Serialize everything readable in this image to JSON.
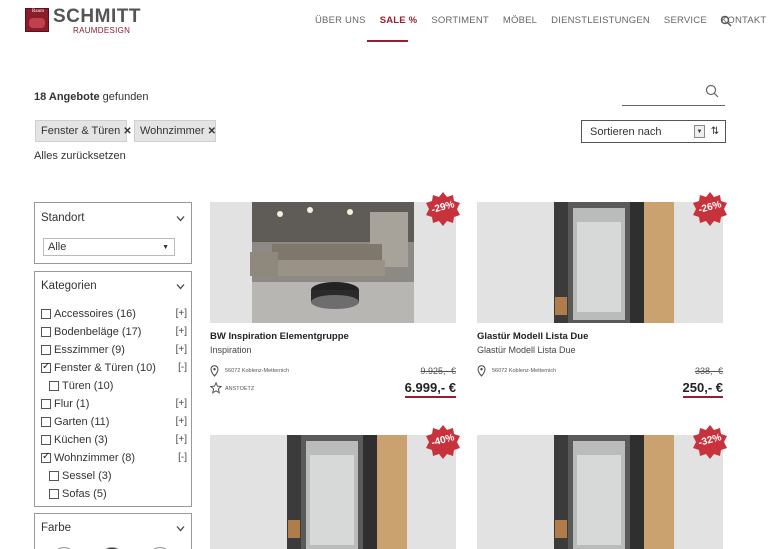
{
  "brand": {
    "name": "SCHMITT",
    "sub": "RAUMDESIGN",
    "mark": "Raum"
  },
  "nav": {
    "items": [
      "ÜBER UNS",
      "SALE %",
      "SORTIMENT",
      "MÖBEL",
      "DIENSTLEISTUNGEN",
      "SERVICE",
      "KONTAKT"
    ],
    "active": "SALE %"
  },
  "results": {
    "count": "18 Angebote",
    "suffix": " gefunden"
  },
  "search": {
    "placeholder": ""
  },
  "filters": {
    "chips": [
      "Fenster & Türen",
      "Wohnzimmer"
    ],
    "reset": "Alles zurücksetzen"
  },
  "sort": {
    "label": "Sortieren nach"
  },
  "sidebar": {
    "standort": {
      "title": "Standort",
      "selected": "Alle"
    },
    "kategorien": {
      "title": "Kategorien",
      "items": [
        {
          "label": "Accessoires (16)",
          "toggle": "[+]",
          "checked": false,
          "sub": false
        },
        {
          "label": "Bodenbeläge (17)",
          "toggle": "[+]",
          "checked": false,
          "sub": false
        },
        {
          "label": "Esszimmer (9)",
          "toggle": "[+]",
          "checked": false,
          "sub": false
        },
        {
          "label": "Fenster & Türen (10)",
          "toggle": "[-]",
          "checked": true,
          "sub": false
        },
        {
          "label": "Türen (10)",
          "toggle": "",
          "checked": false,
          "sub": true
        },
        {
          "label": "Flur (1)",
          "toggle": "[+]",
          "checked": false,
          "sub": false
        },
        {
          "label": "Garten (11)",
          "toggle": "[+]",
          "checked": false,
          "sub": false
        },
        {
          "label": "Küchen (3)",
          "toggle": "[+]",
          "checked": false,
          "sub": false
        },
        {
          "label": "Wohnzimmer (8)",
          "toggle": "[-]",
          "checked": true,
          "sub": false
        },
        {
          "label": "Sessel (3)",
          "toggle": "",
          "checked": false,
          "sub": true
        },
        {
          "label": "Sofas (5)",
          "toggle": "",
          "checked": false,
          "sub": true
        }
      ]
    },
    "farbe": {
      "title": "Farbe"
    }
  },
  "products": [
    {
      "discount": "-29%",
      "title": "BW Inspiration Elementgruppe",
      "subtitle": "Inspiration",
      "location": "56072 Koblenz-Metternich",
      "old_price": "9.925,- €",
      "price": "6.999,- €",
      "note": "ANSTOETZ",
      "image": "sofa"
    },
    {
      "discount": "-26%",
      "title": "Glastür Modell Lista Due",
      "subtitle": "Glastür Modell Lista Due",
      "location": "56072 Koblenz-Metternich",
      "old_price": "338,- €",
      "price": "250,- €",
      "note": "",
      "image": "door"
    },
    {
      "discount": "-40%",
      "image": "door"
    },
    {
      "discount": "-32%",
      "image": "door"
    }
  ],
  "colors": {
    "accent": "#9b1b30",
    "badge": "#c8323c",
    "image_bg": "#e2e2e2"
  }
}
